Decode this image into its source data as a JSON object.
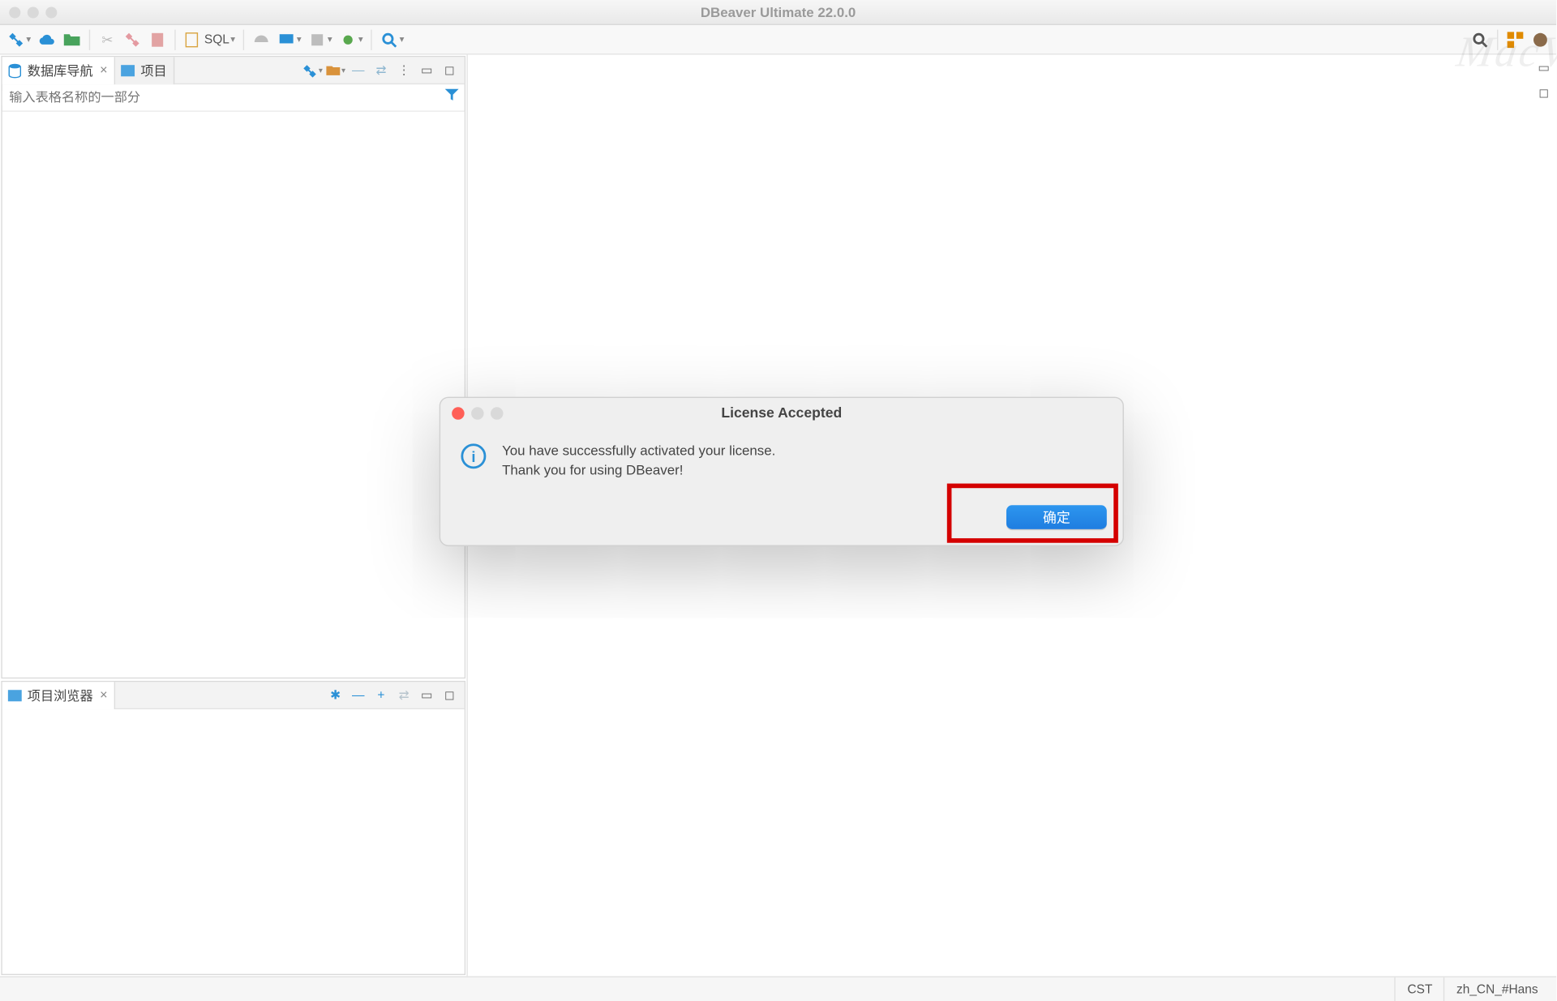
{
  "window": {
    "title": "DBeaver Ultimate 22.0.0"
  },
  "toolbar": {
    "sql_label": "SQL",
    "icons": {
      "new_connection": "plug-icon",
      "cloud": "cloud-icon",
      "import": "folder-refresh-icon",
      "scissors": "cut-icon",
      "plug": "plug-small-icon",
      "paste": "paste-icon",
      "sql": "sql-editor-icon",
      "gauge": "dashboard-icon",
      "presentation": "presentation-icon",
      "device": "device-icon",
      "bug": "bug-icon",
      "search": "search-icon",
      "search_r": "search-icon",
      "perspective": "perspective-icon",
      "app": "dbeaver-icon"
    }
  },
  "panels": {
    "dbnav": {
      "title": "数据库导航",
      "filter_placeholder": "输入表格名称的一部分"
    },
    "projects": {
      "title": "项目"
    },
    "projexp": {
      "title": "项目浏览器"
    }
  },
  "statusbar": {
    "tz": "CST",
    "locale": "zh_CN_#Hans"
  },
  "dialog": {
    "title": "License Accepted",
    "line1": "You have successfully activated your license.",
    "line2": "Thank you for using DBeaver!",
    "ok": "确定"
  },
  "watermark": "MacV"
}
